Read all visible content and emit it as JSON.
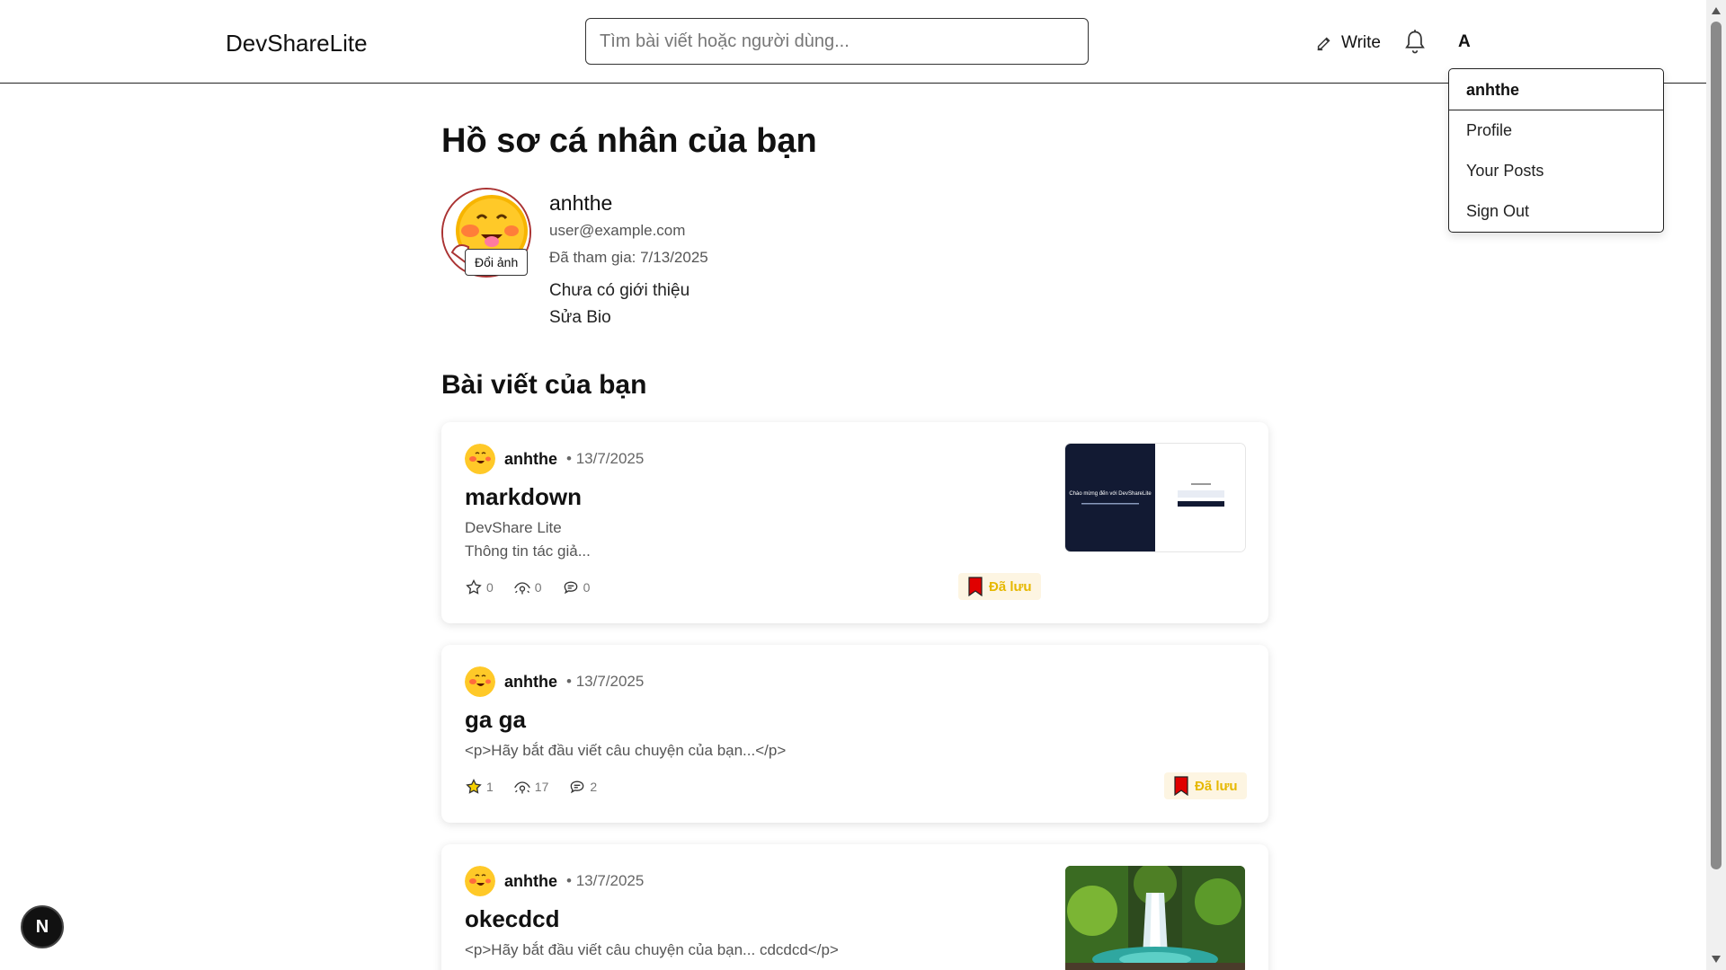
{
  "header": {
    "brand": "DevShareLite",
    "search_placeholder": "Tìm bài viết hoặc người dùng...",
    "write_label": "Write",
    "avatar_letter": "A"
  },
  "dropdown": {
    "username": "anhthe",
    "items": [
      "Profile",
      "Your Posts",
      "Sign Out"
    ]
  },
  "profile": {
    "page_title": "Hồ sơ cá nhân của bạn",
    "change_photo_label": "Đổi ảnh",
    "name": "anhthe",
    "email": "user@example.com",
    "joined": "Đã tham gia: 7/13/2025",
    "bio": "Chưa có giới thiệu",
    "edit_bio_label": "Sửa Bio"
  },
  "posts_section_title": "Bài viết của bạn",
  "posts": [
    {
      "author": "anhthe",
      "date": "• 13/7/2025",
      "title": "markdown",
      "excerpt_line1": "DevShare Lite",
      "excerpt_line2": "Thông tin tác giả...",
      "likes": "0",
      "views": "0",
      "comments": "0",
      "saved_label": "Đã lưu",
      "liked": false,
      "thumbnail": "screenshot",
      "thumb_text": "Chào mừng đến với DevShareLite"
    },
    {
      "author": "anhthe",
      "date": "• 13/7/2025",
      "title": "ga ga",
      "excerpt_line1": "<p>Hãy bắt đầu viết câu chuyện của bạn...</p>",
      "likes": "1",
      "views": "17",
      "comments": "2",
      "saved_label": "Đã lưu",
      "liked": true,
      "thumbnail": "none"
    },
    {
      "author": "anhthe",
      "date": "• 13/7/2025",
      "title": "okecdcd",
      "excerpt_line1": "<p>Hãy bắt đầu viết câu chuyện của bạn... cdcdcd</p>",
      "thumbnail": "waterfall"
    }
  ],
  "floating_button_label": "N",
  "colors": {
    "saved_bg": "#fdf5e2",
    "saved_text": "#e6b800",
    "bookmark": "#e00000",
    "star_filled": "#f5d000"
  },
  "icons": [
    "edit-icon",
    "bell-icon",
    "star-icon",
    "eye-icon",
    "comment-icon",
    "bookmark-icon"
  ]
}
